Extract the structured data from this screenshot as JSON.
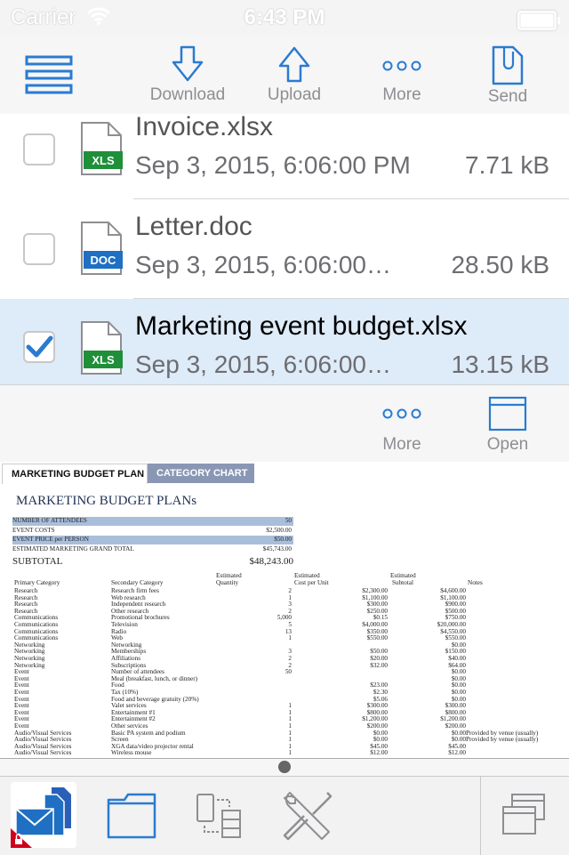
{
  "status": {
    "carrier": "Carrier",
    "time": "6:43 PM"
  },
  "toolbar": {
    "download_label": "Download",
    "upload_label": "Upload",
    "more_label": "More",
    "send_label": "Send"
  },
  "files": [
    {
      "name": "Invoice.xlsx",
      "type_badge": "XLS",
      "date": "Sep 3, 2015, 6:06:00 PM",
      "size": "7.71 kB",
      "selected": false
    },
    {
      "name": "Letter.doc",
      "type_badge": "DOC",
      "date": "Sep 3, 2015, 6:06:00…",
      "size": "28.50 kB",
      "selected": false
    },
    {
      "name": "Marketing event budget.xlsx",
      "type_badge": "XLS",
      "date": "Sep 3, 2015, 6:06:00…",
      "size": "13.15 kB",
      "selected": true
    }
  ],
  "file_actions": {
    "more_label": "More",
    "open_label": "Open"
  },
  "preview": {
    "tabs": [
      "MARKETING BUDGET PLAN",
      "CATEGORY CHART"
    ],
    "title": "MARKETING BUDGET PLANs",
    "summary": [
      {
        "label": "NUMBER OF ATTENDEES",
        "value": "50"
      },
      {
        "label": "EVENT COSTS",
        "value": "$2,500.00"
      },
      {
        "label": "EVENT PRICE per PERSON",
        "value": "$50.00"
      },
      {
        "label": "ESTIMATED MARKETING GRAND TOTAL",
        "value": "$45,743.00"
      }
    ],
    "subtotal_label": "SUBTOTAL",
    "subtotal_value": "$48,243.00",
    "headers": {
      "primary": "Primary Category",
      "secondary": "Secondary Category",
      "qty_top": "Estimated",
      "qty": "Quantity",
      "cost_top": "Estimated",
      "cost": "Cost per Unit",
      "sub_top": "Estimated",
      "sub": "Subtotal",
      "notes": "Notes"
    },
    "rows": [
      [
        "Research",
        "Research firm fees",
        "2",
        "$2,300.00",
        "$4,600.00",
        ""
      ],
      [
        "Research",
        "Web research",
        "1",
        "$1,100.00",
        "$1,100.00",
        ""
      ],
      [
        "Research",
        "Independent research",
        "3",
        "$300.00",
        "$900.00",
        ""
      ],
      [
        "Research",
        "Other research",
        "2",
        "$250.00",
        "$500.00",
        ""
      ],
      [
        "Communications",
        "Promotional brochures",
        "5,000",
        "$0.15",
        "$750.00",
        ""
      ],
      [
        "Communications",
        "Television",
        "5",
        "$4,000.00",
        "$20,000.00",
        ""
      ],
      [
        "Communications",
        "Radio",
        "13",
        "$350.00",
        "$4,550.00",
        ""
      ],
      [
        "Communications",
        "Web",
        "1",
        "$550.00",
        "$550.00",
        ""
      ],
      [
        "Networking",
        "Networking",
        "",
        "",
        "$0.00",
        ""
      ],
      [
        "Networking",
        "Memberships",
        "3",
        "$50.00",
        "$150.00",
        ""
      ],
      [
        "Networking",
        "Affiliations",
        "2",
        "$20.00",
        "$40.00",
        ""
      ],
      [
        "Networking",
        "Subscriptions",
        "2",
        "$32.00",
        "$64.00",
        ""
      ],
      [
        "Event",
        "Number of attendees",
        "50",
        "",
        "$0.00",
        ""
      ],
      [
        "Event",
        "Meal (breakfast, lunch, or dinner)",
        "",
        "",
        "$0.00",
        ""
      ],
      [
        "Event",
        "Food",
        "",
        "$23.00",
        "$0.00",
        ""
      ],
      [
        "Event",
        "Tax (10%)",
        "",
        "$2.30",
        "$0.00",
        ""
      ],
      [
        "Event",
        "Food and beverage gratuity (20%)",
        "",
        "$5.06",
        "$0.00",
        ""
      ],
      [
        "Event",
        "Valet services",
        "1",
        "$300.00",
        "$300.00",
        ""
      ],
      [
        "Event",
        "Entertainment #1",
        "1",
        "$800.00",
        "$800.00",
        ""
      ],
      [
        "Event",
        "Entertainment #2",
        "1",
        "$1,200.00",
        "$1,200.00",
        ""
      ],
      [
        "Event",
        "Other services",
        "1",
        "$200.00",
        "$200.00",
        ""
      ],
      [
        "Audio/Visual Services",
        "Basic PA system and podium",
        "1",
        "$0.00",
        "$0.00",
        "Provided by venue (usually)"
      ],
      [
        "Audio/Visual Services",
        "Screen",
        "1",
        "$0.00",
        "$0.00",
        "Provided by venue (usually)"
      ],
      [
        "Audio/Visual Services",
        "XGA data/video projector rental",
        "1",
        "$45.00",
        "$45.00",
        ""
      ],
      [
        "Audio/Visual Services",
        "Wireless mouse",
        "1",
        "$12.00",
        "$12.00",
        ""
      ]
    ]
  },
  "tabbar": {
    "items": [
      "mail-documents-icon",
      "folder-icon",
      "transfer-icon",
      "tools-icon",
      "windows-icon"
    ]
  },
  "colors": {
    "accent": "#2a7bd0",
    "xls": "#1f8f3a",
    "doc": "#1f6fc2",
    "selected_row": "#deebf8"
  }
}
